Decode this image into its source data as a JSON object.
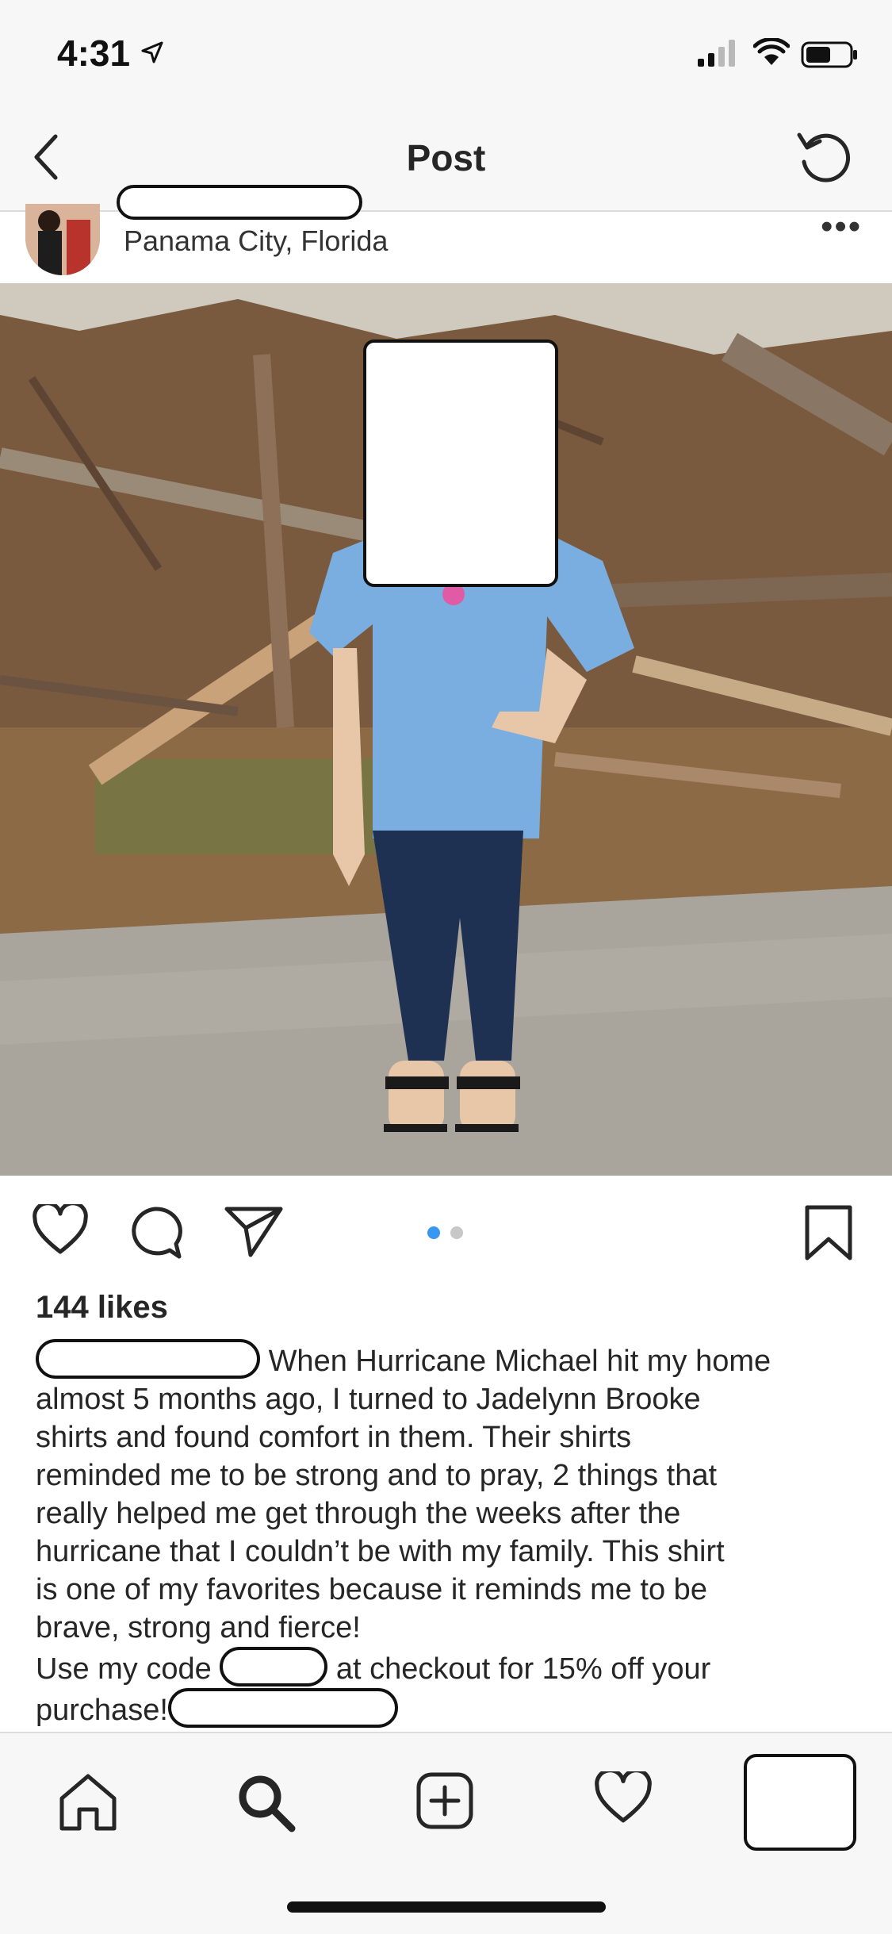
{
  "status_bar": {
    "time": "4:31"
  },
  "nav": {
    "title": "Post"
  },
  "post": {
    "location": "Panama City, Florida",
    "likes": "144 likes",
    "caption_lines": [
      "When Hurricane Michael hit my home",
      "almost 5 months ago, I turned to Jadelynn Brooke",
      "shirts and found comfort in them. Their shirts",
      "reminded me to be strong and to pray, 2 things that",
      "really helped me get through the weeks after the",
      "hurricane that I couldn’t be with my family. This shirt",
      "is one of my favorites because it reminds me to be",
      "brave, strong and fierce!"
    ],
    "code_prefix": "Use my code",
    "code_suffix": "at checkout for 15% off your",
    "purchase": "purchase!",
    "carousel": {
      "count": 2,
      "active": 1
    }
  },
  "icons": {
    "back": "chevron-left-icon",
    "refresh": "refresh-icon",
    "more": "more-icon",
    "like": "heart-icon",
    "comment": "comment-icon",
    "share": "send-icon",
    "save": "bookmark-icon",
    "home": "home-icon",
    "search": "search-icon",
    "add": "add-icon",
    "activity": "heart-icon"
  },
  "colors": {
    "accent": "#3897f0",
    "dot_inactive": "#c7c7c7",
    "text": "#262626"
  }
}
